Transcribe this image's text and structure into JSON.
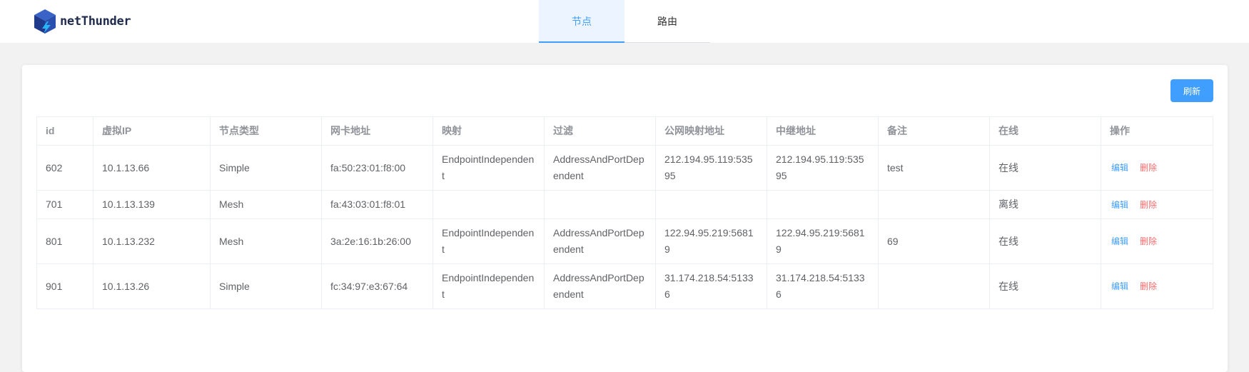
{
  "app": {
    "name": "netThunder"
  },
  "tabs": [
    {
      "label": "节点",
      "active": true
    },
    {
      "label": "路由",
      "active": false
    }
  ],
  "toolbar": {
    "refresh_label": "刷新"
  },
  "table": {
    "headers": [
      "id",
      "虚拟IP",
      "节点类型",
      "网卡地址",
      "映射",
      "过滤",
      "公网映射地址",
      "中继地址",
      "备注",
      "在线",
      "操作"
    ],
    "rows": [
      {
        "id": "602",
        "vip": "10.1.13.66",
        "type": "Simple",
        "mac": "fa:50:23:01:f8:00",
        "mapping": "EndpointIndependent",
        "filter": "AddressAndPortDependent",
        "public": "212.194.95.119:53595",
        "relay": "212.194.95.119:53595",
        "note": "test",
        "online": "在线"
      },
      {
        "id": "701",
        "vip": "10.1.13.139",
        "type": "Mesh",
        "mac": "fa:43:03:01:f8:01",
        "mapping": "",
        "filter": "",
        "public": "",
        "relay": "",
        "note": "",
        "online": "离线"
      },
      {
        "id": "801",
        "vip": "10.1.13.232",
        "type": "Mesh",
        "mac": "3a:2e:16:1b:26:00",
        "mapping": "EndpointIndependent",
        "filter": "AddressAndPortDependent",
        "public": "122.94.95.219:56819",
        "relay": "122.94.95.219:56819",
        "note": "69",
        "online": "在线"
      },
      {
        "id": "901",
        "vip": "10.1.13.26",
        "type": "Simple",
        "mac": "fc:34:97:e3:67:64",
        "mapping": "EndpointIndependent",
        "filter": "AddressAndPortDependent",
        "public": "31.174.218.54:51336",
        "relay": "31.174.218.54:51336",
        "note": "",
        "online": "在线"
      }
    ],
    "actions": {
      "edit_label": "编辑",
      "delete_label": "删除"
    }
  },
  "colors": {
    "accent": "#409eff",
    "danger": "#f56c6c",
    "tab_active_bg": "#ecf5ff"
  }
}
